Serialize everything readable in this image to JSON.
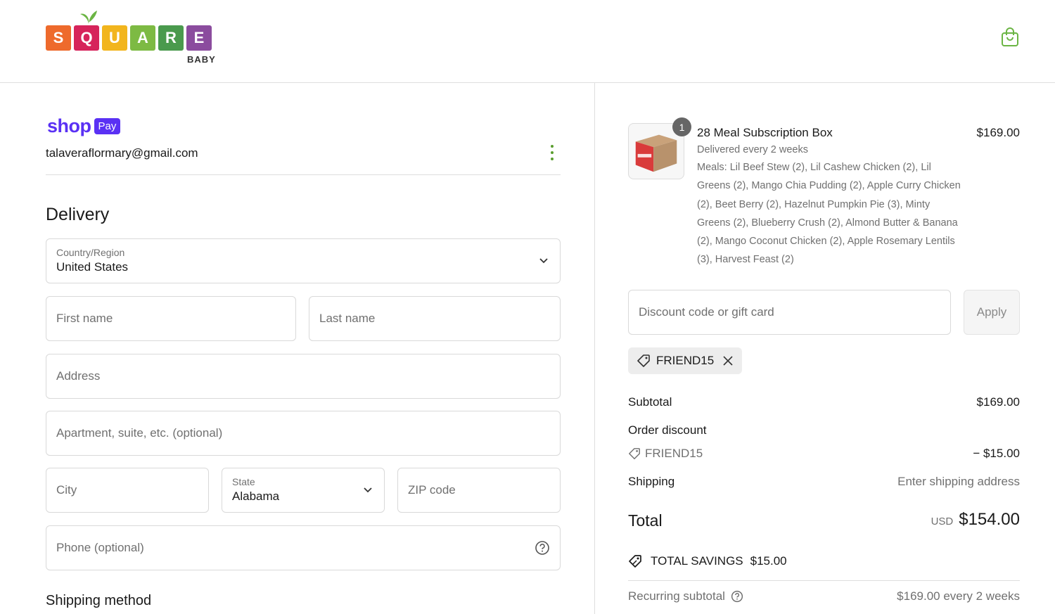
{
  "brand": {
    "letters": [
      "S",
      "Q",
      "U",
      "A",
      "R",
      "E"
    ],
    "letter_colors": [
      "#ee6a2c",
      "#d6245b",
      "#f2b51d",
      "#7dba43",
      "#4a9a4d",
      "#8b4c9e"
    ],
    "subtitle": "BABY",
    "accent": "#6bb544"
  },
  "header": {
    "cart_icon": "shopping-bag-icon"
  },
  "contact": {
    "shop_word": "shop",
    "pay_badge": "Pay",
    "email": "talaveraflormary@gmail.com",
    "menu_icon": "kebab-menu-icon"
  },
  "delivery": {
    "title": "Delivery",
    "country": {
      "label": "Country/Region",
      "value": "United States"
    },
    "first_name": {
      "placeholder": "First name"
    },
    "last_name": {
      "placeholder": "Last name"
    },
    "address": {
      "placeholder": "Address"
    },
    "apartment": {
      "placeholder": "Apartment, suite, etc. (optional)"
    },
    "city": {
      "placeholder": "City"
    },
    "state": {
      "label": "State",
      "value": "Alabama"
    },
    "zip": {
      "placeholder": "ZIP code"
    },
    "phone": {
      "placeholder": "Phone (optional)"
    },
    "shipping_method_title": "Shipping method"
  },
  "order": {
    "item": {
      "quantity": "1",
      "name": "28 Meal Subscription Box",
      "price": "$169.00",
      "frequency": "Delivered every 2 weeks",
      "meals": "Meals: Lil Beef Stew (2), Lil Cashew Chicken (2), Lil Greens (2), Mango Chia Pudding (2), Apple Curry Chicken (2), Beet Berry (2), Hazelnut Pumpkin Pie (3), Minty Greens (2), Blueberry Crush (2), Almond Butter & Banana (2), Mango Coconut Chicken (2), Apple Rosemary Lentils (3), Harvest Feast (2)"
    },
    "discount_placeholder": "Discount code or gift card",
    "apply_label": "Apply",
    "applied_code": "FRIEND15",
    "subtotal_label": "Subtotal",
    "subtotal_value": "$169.00",
    "order_discount_label": "Order discount",
    "discount_code": "FRIEND15",
    "discount_value": "− $15.00",
    "shipping_label": "Shipping",
    "shipping_value": "Enter shipping address",
    "total_label": "Total",
    "total_currency": "USD",
    "total_value": "$154.00",
    "savings_label": "TOTAL SAVINGS",
    "savings_value": "$15.00",
    "recurring_label": "Recurring subtotal",
    "recurring_value": "$169.00 every 2 weeks"
  }
}
